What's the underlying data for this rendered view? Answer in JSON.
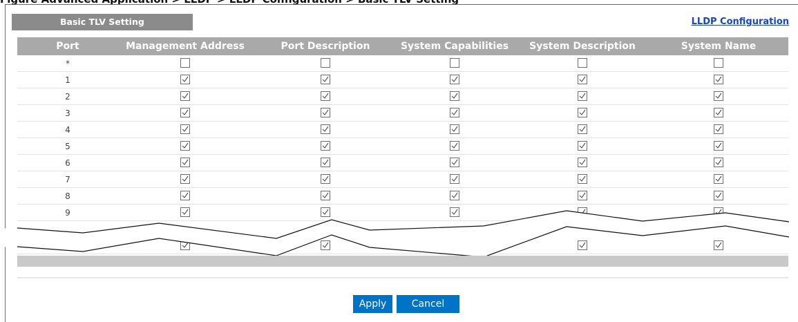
{
  "page": {
    "caption_fragment": "Figure Advanced Application > LLDP > LLDP Configuration > Basic TLV Setting",
    "section_title": "Basic TLV Setting",
    "lldp_link": "LLDP Configuration"
  },
  "table": {
    "headers": [
      "Port",
      "Management Address",
      "Port Description",
      "System Capabilities",
      "System Description",
      "System Name"
    ],
    "rows": [
      {
        "port": "*",
        "checked": [
          false,
          false,
          false,
          false,
          false
        ]
      },
      {
        "port": "1",
        "checked": [
          true,
          true,
          true,
          true,
          true
        ]
      },
      {
        "port": "2",
        "checked": [
          true,
          true,
          true,
          true,
          true
        ]
      },
      {
        "port": "3",
        "checked": [
          true,
          true,
          true,
          true,
          true
        ]
      },
      {
        "port": "4",
        "checked": [
          true,
          true,
          true,
          true,
          true
        ]
      },
      {
        "port": "5",
        "checked": [
          true,
          true,
          true,
          true,
          true
        ]
      },
      {
        "port": "6",
        "checked": [
          true,
          true,
          true,
          true,
          true
        ]
      },
      {
        "port": "7",
        "checked": [
          true,
          true,
          true,
          true,
          true
        ]
      },
      {
        "port": "8",
        "checked": [
          true,
          true,
          true,
          true,
          true
        ]
      },
      {
        "port": "9",
        "checked": [
          true,
          true,
          true,
          true,
          true
        ]
      },
      {
        "port": "",
        "checked": [
          true,
          true,
          true,
          true,
          true
        ]
      }
    ]
  },
  "buttons": {
    "apply": "Apply",
    "cancel": "Cancel"
  },
  "colors": {
    "header_bg": "#a9a9a9",
    "tab_bg": "#8b8b8b",
    "button_bg": "#0073c6",
    "link": "#1a44c8"
  }
}
